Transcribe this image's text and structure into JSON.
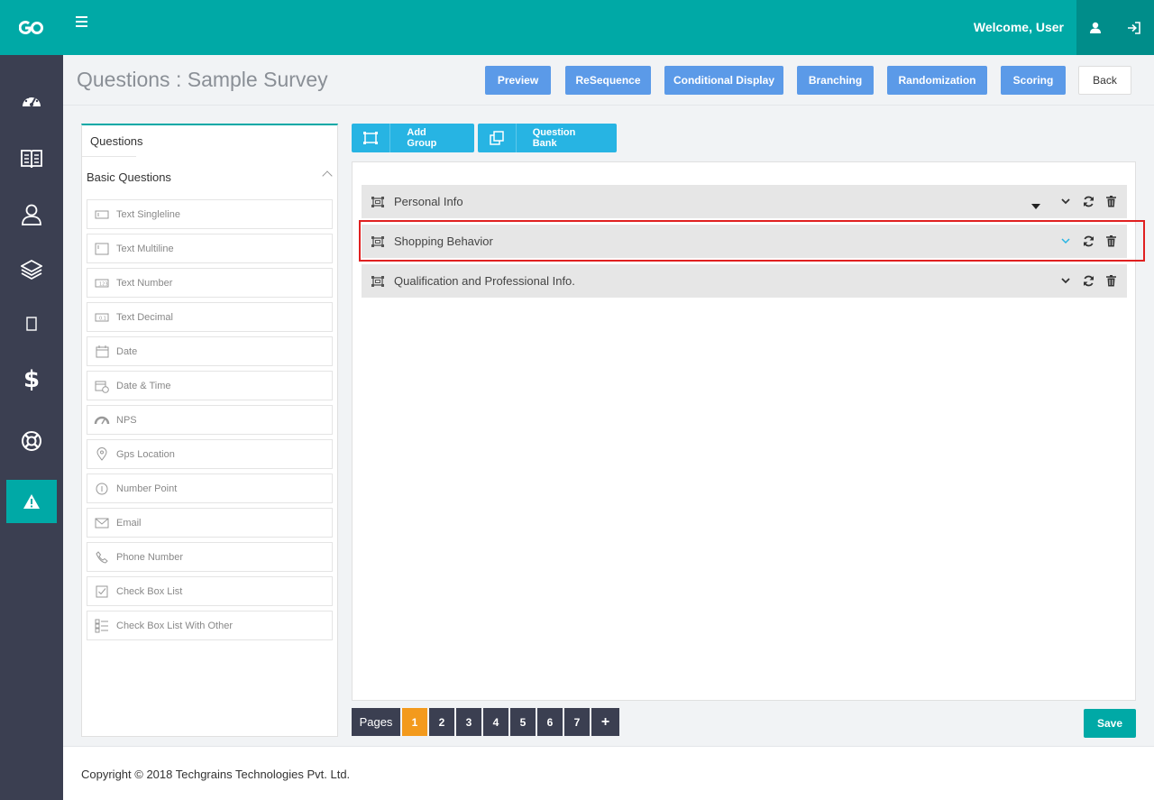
{
  "colors": {
    "accent": "#00a9a6",
    "sidebar": "#3b3f51",
    "header_button": "#5b9ae8",
    "toolbar_button": "#27b4e3",
    "active_page": "#f39a1d",
    "highlight": "#e02020"
  },
  "topbar": {
    "logo": "go-logo-icon",
    "welcome": "Welcome, User"
  },
  "sidebar": {
    "items": [
      "dashboard-icon",
      "book-icon",
      "user-icon",
      "layers-icon",
      "tablet-icon",
      "dollar-icon",
      "support-icon",
      "warning-icon"
    ],
    "active_index": 7
  },
  "header": {
    "title": "Questions : Sample Survey",
    "buttons": {
      "preview": "Preview",
      "resequence": "ReSequence",
      "conditional": "Conditional Display",
      "branching": "Branching",
      "randomization": "Randomization",
      "scoring": "Scoring",
      "back": "Back"
    }
  },
  "left_panel": {
    "tab": "Questions",
    "section": "Basic Questions",
    "items": [
      "Text Singleline",
      "Text Multiline",
      "Text Number",
      "Text Decimal",
      "Date",
      "Date & Time",
      "NPS",
      "Gps Location",
      "Number Point",
      "Email",
      "Phone Number",
      "Check Box List",
      "Check Box List With Other"
    ]
  },
  "toolbar": {
    "add_group": "Add Group",
    "question_bank": "Question Bank"
  },
  "groups": [
    {
      "label": "Personal Info"
    },
    {
      "label": "Shopping Behavior",
      "highlighted": true
    },
    {
      "label": "Qualification and Professional Info."
    }
  ],
  "pager": {
    "label": "Pages",
    "pages": [
      "1",
      "2",
      "3",
      "4",
      "5",
      "6",
      "7"
    ],
    "current": "1",
    "add": "+"
  },
  "save": "Save",
  "footer": "Copyright © 2018 Techgrains Technologies Pvt. Ltd."
}
